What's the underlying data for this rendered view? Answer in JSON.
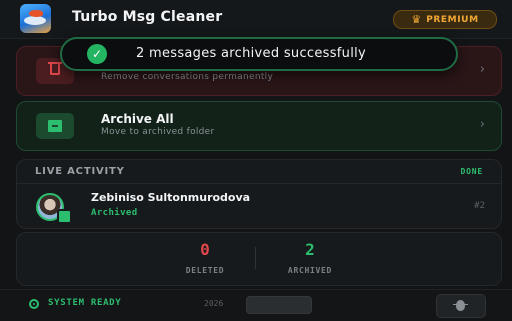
{
  "header": {
    "title": "Turbo Msg Cleaner",
    "premium_label": "PREMIUM",
    "crown_icon": "crown-icon"
  },
  "toast": {
    "message": "2 messages archived successfully",
    "icon": "check-circle-icon"
  },
  "actions": {
    "delete": {
      "subtitle": "Remove conversations permanently",
      "icon": "trash-icon"
    },
    "archive": {
      "title": "Archive All",
      "subtitle": "Move to archived folder",
      "icon": "archive-box-icon"
    }
  },
  "activity": {
    "title": "LIVE ACTIVITY",
    "status": "DONE",
    "item": {
      "name": "Zebiniso Sultonmurodova",
      "state": "Archived",
      "index": "#2"
    }
  },
  "stats": {
    "deleted_value": "0",
    "deleted_label": "DELETED",
    "archived_value": "2",
    "archived_label": "ARCHIVED"
  },
  "footer": {
    "system_status": "SYSTEM READY",
    "year": "2026",
    "bug_icon": "bug-icon"
  },
  "colors": {
    "accent_green": "#2dbd6e",
    "danger_red": "#e0474a",
    "premium_gold": "#f0a834",
    "background": "#121416"
  }
}
